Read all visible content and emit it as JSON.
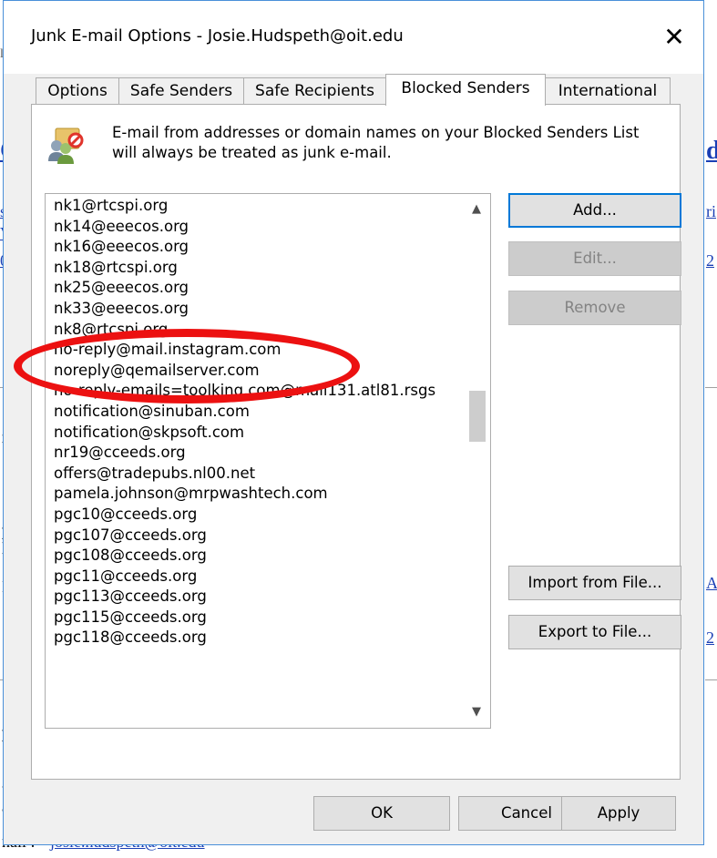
{
  "dialog": {
    "title": "Junk E-mail Options - Josie.Hudspeth@oit.edu",
    "close_glyph": "✕"
  },
  "tabs": [
    {
      "label": "Options",
      "active": false
    },
    {
      "label": "Safe Senders",
      "active": false
    },
    {
      "label": "Safe Recipients",
      "active": false
    },
    {
      "label": "Blocked Senders",
      "active": true
    },
    {
      "label": "International",
      "active": false
    }
  ],
  "blocked_senders": {
    "icon": "blocked-users-icon",
    "description": "E-mail from addresses or domain names on your Blocked Senders List will always be treated as junk e-mail.",
    "list": [
      "nk1@rtcspi.org",
      "nk14@eeecos.org",
      "nk16@eeecos.org",
      "nk18@rtcspi.org",
      "nk25@eeecos.org",
      "nk33@eeecos.org",
      "nk8@rtcspi.org",
      "no-reply@mail.instagram.com",
      "noreply@qemailserver.com",
      "no-reply-emails=toolking.com@mail131.atl81.rsgs",
      "notification@sinuban.com",
      "notification@skpsoft.com",
      "nr19@cceeds.org",
      "offers@tradepubs.nl00.net",
      "pamela.johnson@mrpwashtech.com",
      "pgc10@cceeds.org",
      "pgc107@cceeds.org",
      "pgc108@cceeds.org",
      "pgc11@cceeds.org",
      "pgc113@cceeds.org",
      "pgc115@cceeds.org",
      "pgc118@cceeds.org"
    ],
    "buttons": {
      "add": "Add...",
      "edit": "Edit...",
      "remove": "Remove",
      "import": "Import from File...",
      "export": "Export to File..."
    }
  },
  "footer": {
    "ok": "OK",
    "cancel": "Cancel",
    "apply": "Apply"
  },
  "background": {
    "email_label": "nail :",
    "email_value": "josie.hudspeth@oit.edu"
  },
  "annotation_color": "#ec1111"
}
